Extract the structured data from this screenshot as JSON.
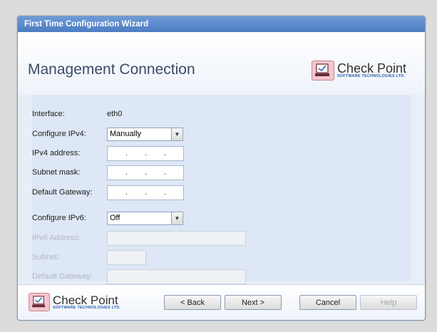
{
  "window": {
    "title": "First Time Configuration Wizard"
  },
  "header": {
    "page_title": "Management Connection",
    "logo": {
      "brand": "Check Point",
      "tagline": "SOFTWARE TECHNOLOGIES LTD.",
      "icon": "check-point-logo-icon"
    }
  },
  "form": {
    "interface": {
      "label": "Interface:",
      "value": "eth0"
    },
    "configure_ipv4": {
      "label": "Configure IPv4:",
      "value": "Manually"
    },
    "ipv4_address": {
      "label": "IPv4 address:",
      "separator": "."
    },
    "subnet_mask": {
      "label": "Subnet mask:",
      "separator": "."
    },
    "default_gateway": {
      "label": "Default Gateway:",
      "separator": "."
    },
    "configure_ipv6": {
      "label": "Configure IPv6:",
      "value": "Off"
    },
    "ipv6_address": {
      "label": "IPv6 Address:"
    },
    "subnet": {
      "label": "Subnet:"
    },
    "ipv6_gateway": {
      "label": "Default Gateway:"
    }
  },
  "footer": {
    "logo": {
      "brand": "Check Point",
      "tagline": "SOFTWARE TECHNOLOGIES LTD."
    },
    "buttons": {
      "back": "< Back",
      "next": "Next >",
      "cancel": "Cancel",
      "help": "Help"
    }
  },
  "colors": {
    "titlebar": "#4c7cc2",
    "form_bg": "#dde7f5",
    "title_text": "#3b4c66"
  }
}
